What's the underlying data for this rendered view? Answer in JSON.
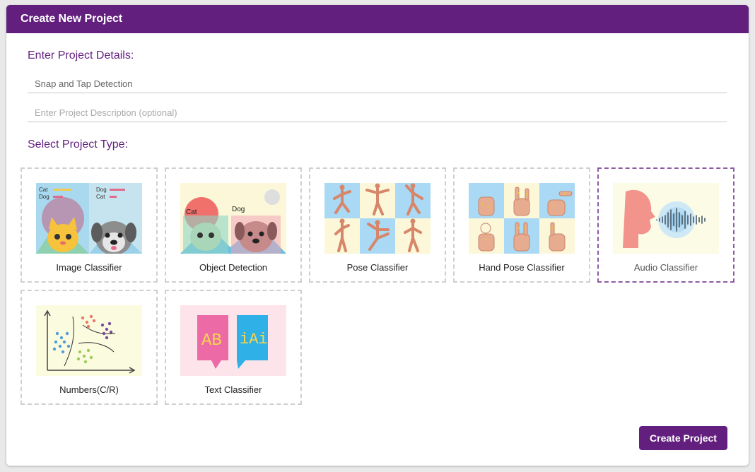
{
  "dialog": {
    "title": "Create New Project"
  },
  "details": {
    "heading": "Enter Project Details:",
    "name_value": "Snap and Tap Detection",
    "description_placeholder": "Enter Project Description (optional)"
  },
  "types": {
    "heading": "Select Project Type:",
    "selected": "Audio Classifier",
    "items": [
      {
        "label": "Image Classifier",
        "thumb_text": [
          "Cat",
          "Dog",
          "Dog",
          "Cat"
        ]
      },
      {
        "label": "Object Detection",
        "thumb_text": [
          "Cat",
          "Dog"
        ]
      },
      {
        "label": "Pose Classifier"
      },
      {
        "label": "Hand Pose Classifier"
      },
      {
        "label": "Audio Classifier"
      },
      {
        "label": "Numbers(C/R)"
      },
      {
        "label": "Text Classifier",
        "thumb_text": [
          "AB",
          "iAi"
        ]
      }
    ]
  },
  "actions": {
    "create_label": "Create Project"
  },
  "colors": {
    "primary": "#621f7e",
    "selected_border": "#8e5aa3",
    "card_border": "#cfcfcf"
  }
}
